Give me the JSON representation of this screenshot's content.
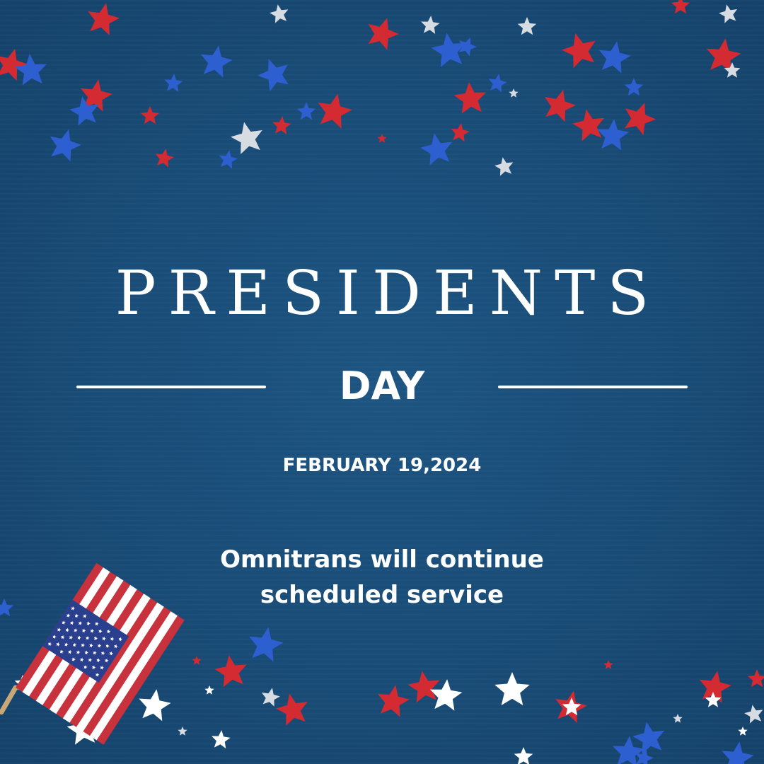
{
  "headline": "PRESIDENTS",
  "subheadline": "DAY",
  "date": "FEBRUARY 19,2024",
  "message": {
    "line1": "Omnitrans will continue",
    "line2": "scheduled service"
  },
  "colors": {
    "background": "#184b76",
    "text": "#ffffff",
    "star_red": "#d42a32",
    "star_blue": "#2d5fd0",
    "star_silver": "#d7dbe2",
    "star_white": "#ffffff",
    "flag_red": "#c8323c",
    "flag_blue": "#2b3f8f"
  },
  "decorations": [
    "star-confetti",
    "american-flag-icon"
  ]
}
